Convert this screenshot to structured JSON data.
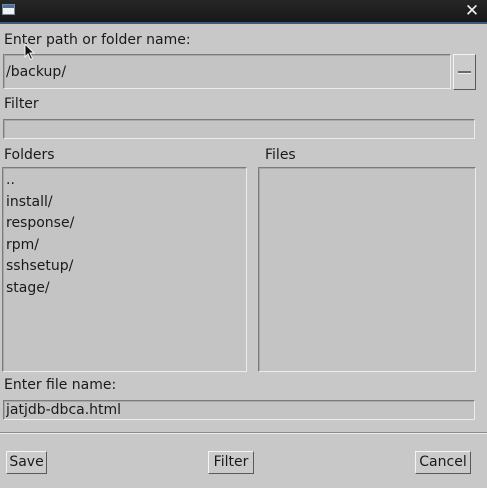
{
  "titlebar": {
    "close_glyph": "✕"
  },
  "path": {
    "label": "Enter path or folder name:",
    "value": "/backup/"
  },
  "filter": {
    "label": "Filter",
    "value": ""
  },
  "folders": {
    "label": "Folders",
    "items": [
      "..",
      "install/",
      "response/",
      "rpm/",
      "sshsetup/",
      "stage/"
    ]
  },
  "files": {
    "label": "Files",
    "items": []
  },
  "filename": {
    "label": "Enter file name:",
    "value": "jatjdb-dbca.html"
  },
  "buttons": {
    "save": "Save",
    "filter": "Filter",
    "cancel": "Cancel"
  },
  "icons": {
    "window": "window-icon",
    "close": "close-icon",
    "dropdown": "dropdown-icon",
    "cursor": "mouse-pointer-icon"
  },
  "colors": {
    "titlebar": "#1e1e1e",
    "titlebar_accent": "#3c5a7a",
    "background": "#c8c8c8",
    "field": "#c4c4c4"
  }
}
